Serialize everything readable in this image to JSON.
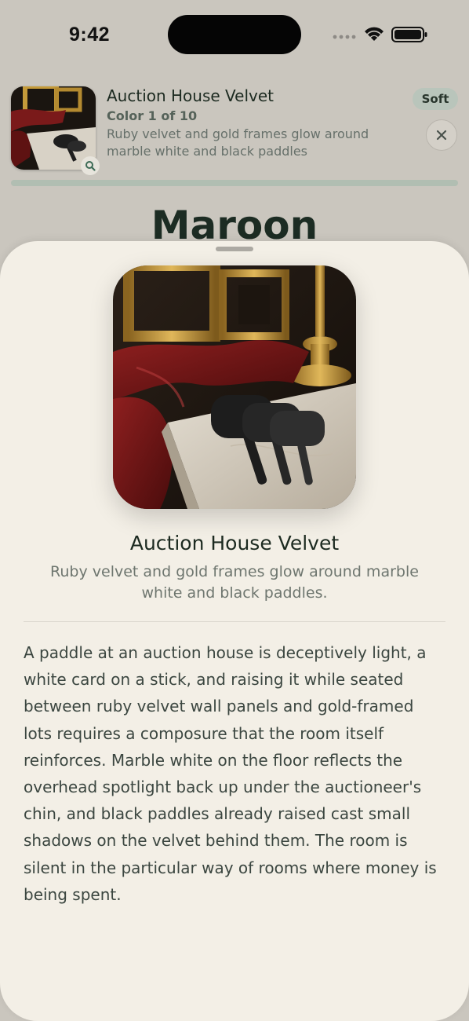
{
  "status_bar": {
    "time": "9:42"
  },
  "header": {
    "title": "Auction House Velvet",
    "counter": "Color 1 of 10",
    "description": "Ruby velvet and gold frames glow around marble white and black paddles",
    "badge": "Soft",
    "progress": 1.0
  },
  "color_name": "Maroon",
  "sheet": {
    "title": "Auction House Velvet",
    "subtitle": "Ruby velvet and gold frames glow around marble white and black paddles.",
    "body": "A paddle at an auction house is deceptively light, a white card on a stick, and raising it while seated between ruby velvet wall panels and gold-framed lots requires a composure that the room itself reinforces. Marble white on the floor reflects the overhead spotlight back up under the auctioneer's chin, and black paddles already raised cast small shadows on the velvet behind them. The room is silent in the particular way of rooms where money is being spent."
  },
  "icons": {
    "signal": "cellular-signal-icon",
    "wifi": "wifi-icon",
    "battery": "battery-icon",
    "zoom": "magnifier-icon",
    "close": "close-icon"
  },
  "colors": {
    "maroon_velvet": "#7a1a1a",
    "gold": "#c59b3a",
    "marble": "#d8d2c6",
    "paddle": "#1e1e1e",
    "accent_green": "#b9c5bb"
  }
}
